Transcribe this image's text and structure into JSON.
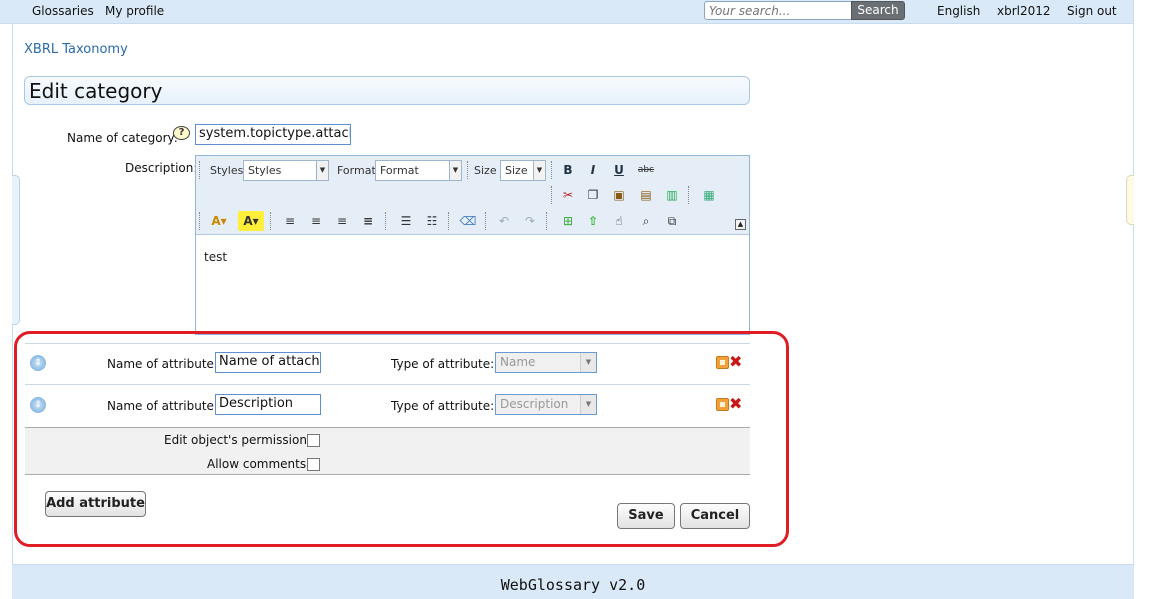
{
  "topbar": {
    "nav": [
      "Glossaries",
      "My profile"
    ],
    "search": {
      "placeholder": "Your search...",
      "button": "Search"
    },
    "language": "English",
    "user": "xbrl2012",
    "signout": "Sign out"
  },
  "breadcrumb": "XBRL Taxonomy",
  "page_title": "Edit category",
  "form": {
    "name_label": "Name of category:",
    "help_icon": "?",
    "name_value": "system.topictype.attachm",
    "description_label": "Description:",
    "editor": {
      "styles_label": "Styles",
      "styles_value": "Styles",
      "format_label": "Format",
      "format_value": "Format",
      "size_label": "Size",
      "size_value": "Size",
      "content": "test"
    }
  },
  "attributes": [
    {
      "label": "Name of attribute:",
      "name": "Name of attachm",
      "type_label": "Type of attribute:",
      "type": "Name"
    },
    {
      "label": "Name of attribute:",
      "name": "Description",
      "type_label": "Type of attribute:",
      "type": "Description"
    }
  ],
  "options": {
    "permissions_label": "Edit object's permissions:",
    "comments_label": "Allow comments:"
  },
  "buttons": {
    "add_attribute": "Add attribute",
    "save": "Save",
    "cancel": "Cancel"
  },
  "footer": "WebGlossary v2.0",
  "colors": {
    "topbar": "#dae9f7",
    "link": "#2a6aa8",
    "highlight": "#e01d25"
  }
}
